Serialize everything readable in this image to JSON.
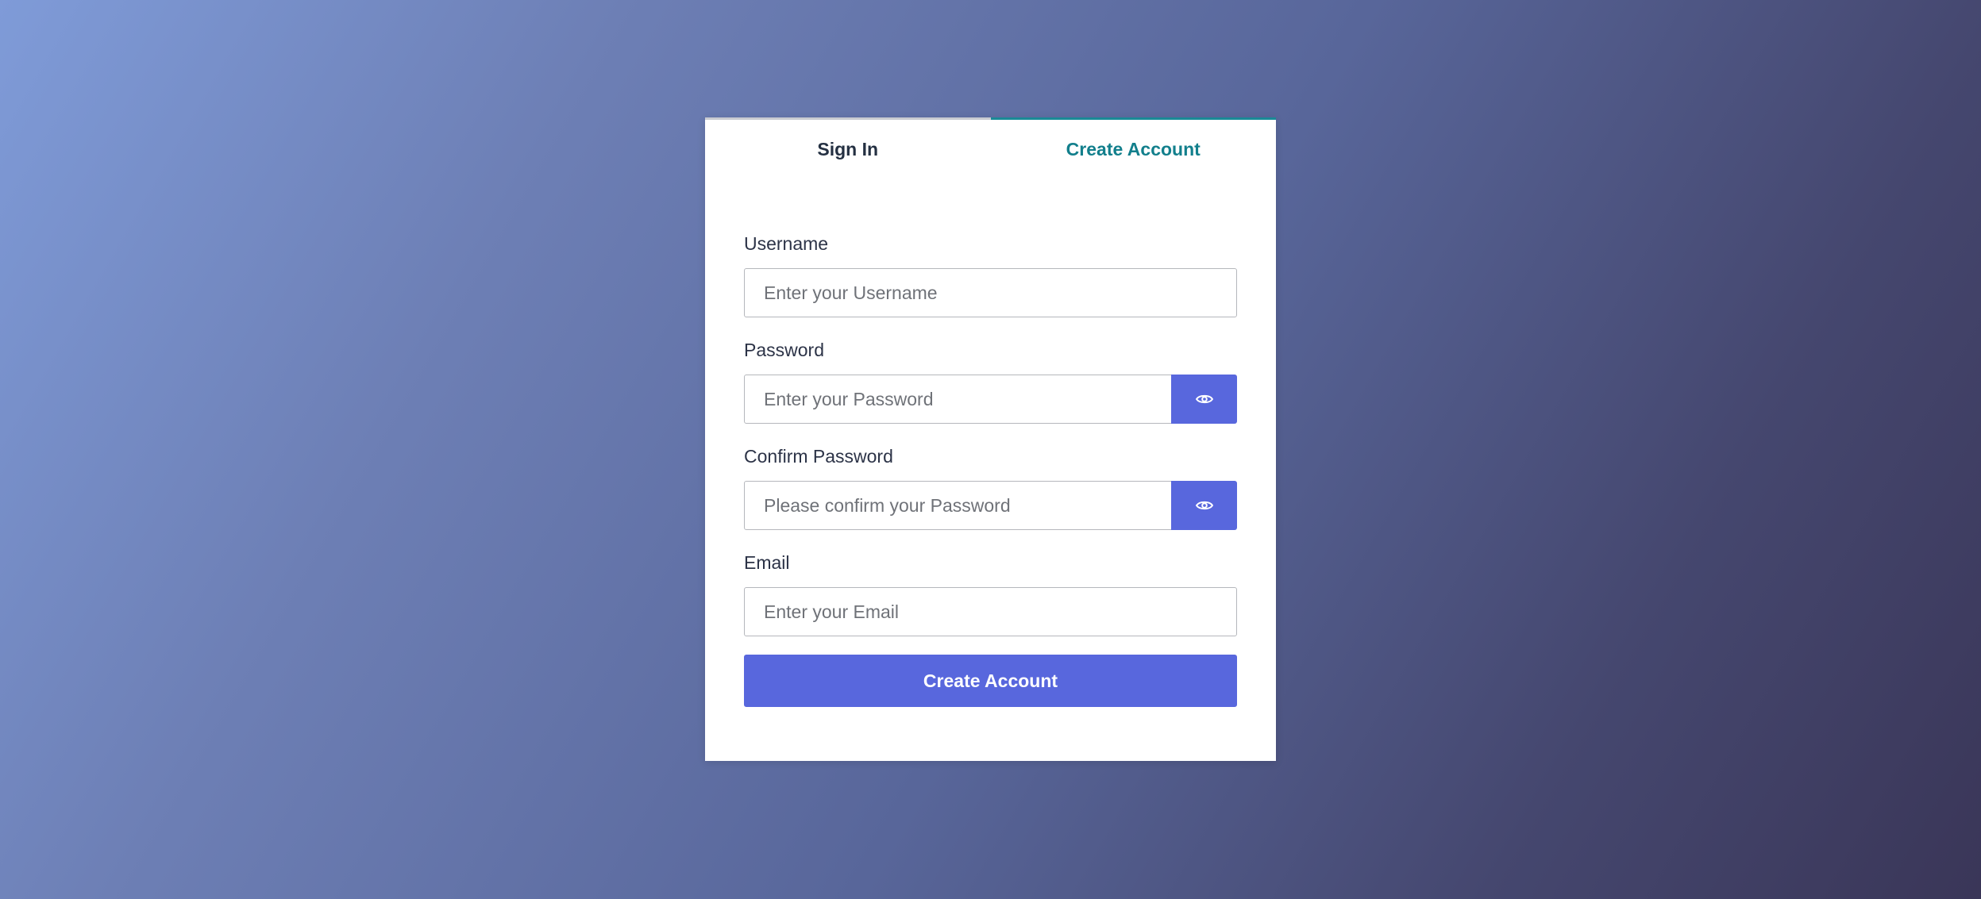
{
  "tabs": {
    "sign_in": "Sign In",
    "create_account": "Create Account",
    "active": "create_account"
  },
  "form": {
    "username": {
      "label": "Username",
      "placeholder": "Enter your Username",
      "value": ""
    },
    "password": {
      "label": "Password",
      "placeholder": "Enter your Password",
      "value": "",
      "toggle_icon": "eye-icon"
    },
    "confirm_password": {
      "label": "Confirm Password",
      "placeholder": "Please confirm your Password",
      "value": "",
      "toggle_icon": "eye-icon"
    },
    "email": {
      "label": "Email",
      "placeholder": "Enter your Email",
      "value": ""
    },
    "submit_label": "Create Account"
  },
  "colors": {
    "accent": "#5867dd",
    "active_tab": "#127f8c",
    "inactive_tab": "#243042"
  }
}
